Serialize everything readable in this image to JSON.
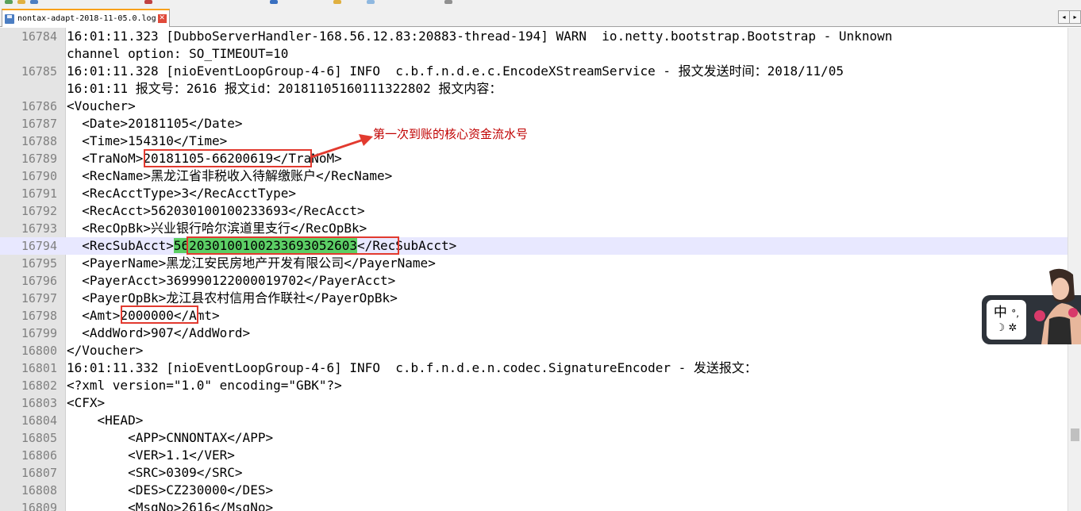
{
  "tab": {
    "label": "nontax-adapt-2018-11-05.0.log",
    "close_glyph": "✕"
  },
  "tab_nav": {
    "left": "◂",
    "right": "▸"
  },
  "lines": [
    {
      "num": "16784",
      "parts": [
        {
          "t": "16:01:11.323 [DubboServerHandler-168.56.12.83:20883-thread-194] WARN  io.netty.bootstrap.Bootstrap - Unknown"
        }
      ]
    },
    {
      "num": "",
      "parts": [
        {
          "t": "channel option: SO_TIMEOUT=10"
        }
      ]
    },
    {
      "num": "16785",
      "parts": [
        {
          "t": "16:01:11.328 [nioEventLoopGroup-4-6] INFO  c.b.f.n.d.e.c.EncodeXStreamService - 报文发送时间：2018/11/05"
        }
      ]
    },
    {
      "num": "",
      "parts": [
        {
          "t": "16:01:11 报文号：2616 报文id：20181105160111322802 报文内容："
        }
      ]
    },
    {
      "num": "16786",
      "parts": [
        {
          "t": "<Voucher>"
        }
      ]
    },
    {
      "num": "16787",
      "parts": [
        {
          "t": "  <Date>20181105</Date>"
        }
      ]
    },
    {
      "num": "16788",
      "parts": [
        {
          "t": "  <Time>154310</Time>"
        }
      ]
    },
    {
      "num": "16789",
      "parts": [
        {
          "t": "  <TraNoM>20181105-66200619</TraNoM>"
        }
      ]
    },
    {
      "num": "16790",
      "parts": [
        {
          "t": "  <RecName>黑龙江省非税收入待解缴账户</RecName>"
        }
      ]
    },
    {
      "num": "16791",
      "parts": [
        {
          "t": "  <RecAcctType>3</RecAcctType>"
        }
      ]
    },
    {
      "num": "16792",
      "parts": [
        {
          "t": "  <RecAcct>562030100100233693</RecAcct>"
        }
      ]
    },
    {
      "num": "16793",
      "parts": [
        {
          "t": "  <RecOpBk>兴业银行哈尔滨道里支行</RecOpBk>"
        }
      ]
    },
    {
      "num": "16794",
      "current": true,
      "parts": [
        {
          "t": "  <RecSubAcct>"
        },
        {
          "t": "562030100100233693052603",
          "hl": true
        },
        {
          "t": "</RecSubAcct>"
        }
      ]
    },
    {
      "num": "16795",
      "parts": [
        {
          "t": "  <PayerName>黑龙江安民房地产开发有限公司</PayerName>"
        }
      ]
    },
    {
      "num": "16796",
      "parts": [
        {
          "t": "  <PayerAcct>369990122000019702</PayerAcct>"
        }
      ]
    },
    {
      "num": "16797",
      "parts": [
        {
          "t": "  <PayerOpBk>龙江县农村信用合作联社</PayerOpBk>"
        }
      ]
    },
    {
      "num": "16798",
      "parts": [
        {
          "t": "  <Amt>2000000</Amt>"
        }
      ]
    },
    {
      "num": "16799",
      "parts": [
        {
          "t": "  <AddWord>907</AddWord>"
        }
      ]
    },
    {
      "num": "16800",
      "parts": [
        {
          "t": "</Voucher>"
        }
      ]
    },
    {
      "num": "16801",
      "parts": [
        {
          "t": "16:01:11.332 [nioEventLoopGroup-4-6] INFO  c.b.f.n.d.e.n.codec.SignatureEncoder - 发送报文："
        }
      ]
    },
    {
      "num": "16802",
      "parts": [
        {
          "t": "<?xml version=\"1.0\" encoding=\"GBK\"?>"
        }
      ]
    },
    {
      "num": "16803",
      "parts": [
        {
          "t": "<CFX>"
        }
      ]
    },
    {
      "num": "16804",
      "parts": [
        {
          "t": "    <HEAD>"
        }
      ]
    },
    {
      "num": "16805",
      "parts": [
        {
          "t": "        <APP>CNNONTAX</APP>"
        }
      ]
    },
    {
      "num": "16806",
      "parts": [
        {
          "t": "        <VER>1.1</VER>"
        }
      ]
    },
    {
      "num": "16807",
      "parts": [
        {
          "t": "        <SRC>0309</SRC>"
        }
      ]
    },
    {
      "num": "16808",
      "parts": [
        {
          "t": "        <DES>CZ230000</DES>"
        }
      ]
    },
    {
      "num": "16809",
      "parts": [
        {
          "t": "        <MsgNo>2616</MsgNo>"
        }
      ]
    }
  ],
  "annotation": {
    "text": "第一次到账的核心资金流水号",
    "color": "#e23a2f"
  },
  "ime_widget": {
    "mode_label": "中",
    "punct_label": "°,",
    "row2_label": "☽ ✲"
  },
  "colors": {
    "accent_tab": "#f8a11b",
    "highlight_green": "#5ccf65",
    "current_line": "#e8e8ff",
    "annotation_red": "#e23a2f"
  }
}
